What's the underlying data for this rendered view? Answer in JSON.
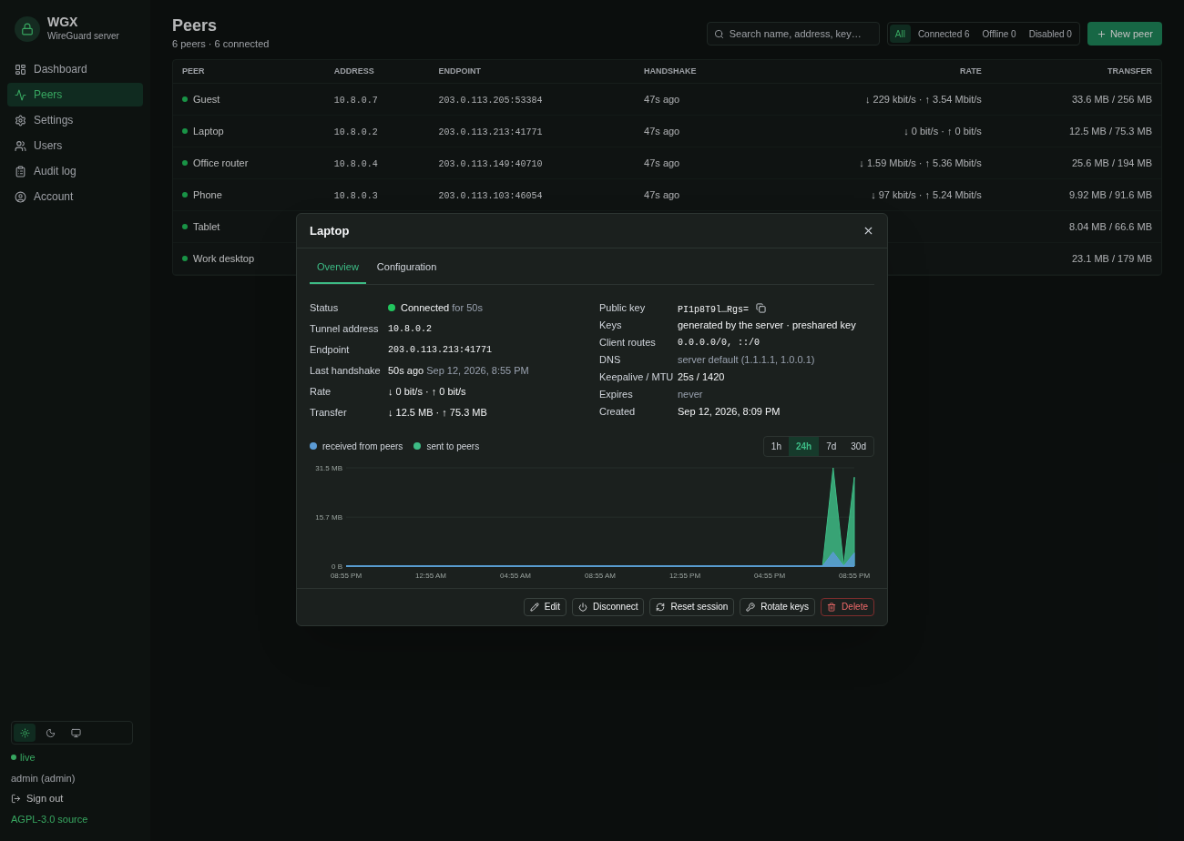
{
  "sidebar": {
    "brand": "WGX",
    "subtitle": "WireGuard server",
    "items": [
      {
        "kind": "dashboard",
        "label": "Dashboard",
        "selected": false
      },
      {
        "kind": "peers",
        "label": "Peers",
        "selected": true
      },
      {
        "kind": "settings",
        "label": "Settings",
        "selected": false
      },
      {
        "kind": "users",
        "label": "Users",
        "selected": false
      },
      {
        "kind": "audit",
        "label": "Audit log",
        "selected": false
      },
      {
        "kind": "account",
        "label": "Account",
        "selected": false
      }
    ],
    "theme_options": [
      {
        "kind": "light",
        "selected": true
      },
      {
        "kind": "dark",
        "selected": false
      },
      {
        "kind": "system",
        "selected": false
      }
    ],
    "live": "live",
    "user": "admin (admin)",
    "sign_out": "Sign out",
    "footer_link": "AGPL-3.0 source"
  },
  "page": {
    "title": "Peers",
    "subtitle": "6 peers · 6 connected",
    "search": {
      "placeholder": "Search name, address, key…"
    },
    "filters": [
      {
        "label": "All",
        "selected": true
      },
      {
        "label": "Connected 6",
        "selected": false
      },
      {
        "label": "Offline 0",
        "selected": false
      },
      {
        "label": "Disabled 0",
        "selected": false
      }
    ],
    "new_button": "New peer"
  },
  "table": {
    "columns": [
      "PEER",
      "ADDRESS",
      "ENDPOINT",
      "HANDSHAKE",
      "RATE",
      "TRANSFER"
    ],
    "rows": [
      {
        "connected": true,
        "name": "Guest",
        "address": "10.8.0.7",
        "endpoint": "203.0.113.205:53384",
        "handshake": "47s ago",
        "rate": "↓ 229 kbit/s · ↑ 3.54 Mbit/s",
        "transfer": "33.6 MB / 256 MB"
      },
      {
        "connected": true,
        "name": "Laptop",
        "address": "10.8.0.2",
        "endpoint": "203.0.113.213:41771",
        "handshake": "47s ago",
        "rate": "↓ 0 bit/s · ↑ 0 bit/s",
        "transfer": "12.5 MB / 75.3 MB"
      },
      {
        "connected": true,
        "name": "Office router",
        "address": "10.8.0.4",
        "endpoint": "203.0.113.149:40710",
        "handshake": "47s ago",
        "rate": "↓ 1.59 Mbit/s · ↑ 5.36 Mbit/s",
        "transfer": "25.6 MB / 194 MB"
      },
      {
        "connected": true,
        "name": "Phone",
        "address": "10.8.0.3",
        "endpoint": "203.0.113.103:46054",
        "handshake": "47s ago",
        "rate": "↓ 97 kbit/s · ↑ 5.24 Mbit/s",
        "transfer": "9.92 MB / 91.6 MB"
      },
      {
        "connected": true,
        "name": "Tablet",
        "transfer": "8.04 MB / 66.6 MB"
      },
      {
        "connected": true,
        "name": "Work desktop",
        "transfer": "23.1 MB / 179 MB"
      }
    ]
  },
  "dialog": {
    "title": "Laptop",
    "tabs": [
      {
        "label": "Overview",
        "selected": true
      },
      {
        "label": "Configuration",
        "selected": false
      }
    ],
    "left": [
      {
        "kind": "status",
        "label": "Status",
        "value": "Connected",
        "note": "for 50s",
        "connected": true
      },
      {
        "kind": "mono",
        "label": "Tunnel address",
        "value": "10.8.0.2"
      },
      {
        "kind": "mono",
        "label": "Endpoint",
        "value": "203.0.113.213:41771"
      },
      {
        "kind": "text",
        "label": "Last handshake",
        "value": "50s ago",
        "note": "Sep 12, 2026, 8:55 PM"
      },
      {
        "kind": "text",
        "label": "Rate",
        "value": "↓ 0 bit/s · ↑ 0 bit/s"
      },
      {
        "kind": "text",
        "label": "Transfer",
        "value": "↓ 12.5 MB · ↑ 75.3 MB"
      }
    ],
    "right": [
      {
        "kind": "key",
        "label": "Public key",
        "value": "PI1p8T9l…Rgs="
      },
      {
        "kind": "text",
        "label": "Keys",
        "value": "generated by the server · preshared key"
      },
      {
        "kind": "mono",
        "label": "Client routes",
        "value": "0.0.0.0/0, ::/0"
      },
      {
        "kind": "muted",
        "label": "DNS",
        "value": "server default (1.1.1.1, 1.0.0.1)"
      },
      {
        "kind": "text",
        "label": "Keepalive / MTU",
        "value": "25s / 1420"
      },
      {
        "kind": "muted",
        "label": "Expires",
        "value": "never"
      },
      {
        "kind": "text",
        "label": "Created",
        "value": "Sep 12, 2026, 8:09 PM"
      }
    ],
    "ranges": [
      {
        "label": "1h",
        "selected": false
      },
      {
        "label": "24h",
        "selected": true
      },
      {
        "label": "7d",
        "selected": false
      },
      {
        "label": "30d",
        "selected": false
      }
    ],
    "chart_data": {
      "type": "area",
      "categories": [
        "08:55 PM",
        null,
        null,
        null,
        null,
        null,
        null,
        null,
        "12:55 AM",
        null,
        null,
        null,
        null,
        null,
        null,
        null,
        "04:55 AM",
        null,
        null,
        null,
        null,
        null,
        null,
        null,
        "08:55 AM",
        null,
        null,
        null,
        null,
        null,
        null,
        null,
        "12:55 PM",
        null,
        null,
        null,
        null,
        null,
        null,
        null,
        "04:55 PM",
        null,
        null,
        null,
        null,
        null,
        null,
        null,
        "08:55 PM"
      ],
      "series": [
        {
          "name": "received from peers",
          "color": "#5b9bd5",
          "values": [
            0,
            0,
            0,
            0,
            0,
            0,
            0,
            0,
            0,
            0,
            0,
            0,
            0,
            0,
            0,
            0,
            0,
            0,
            0,
            0,
            0,
            0,
            0,
            0,
            0,
            0,
            0,
            0,
            0,
            0,
            0,
            0,
            0,
            0,
            0,
            0,
            0,
            0,
            0,
            0,
            0,
            0,
            0,
            0,
            0,
            0,
            4.5,
            0,
            4.2
          ]
        },
        {
          "name": "sent to peers",
          "color": "#3dbb85",
          "values": [
            0,
            0,
            0,
            0,
            0,
            0,
            0,
            0,
            0,
            0,
            0,
            0,
            0,
            0,
            0,
            0,
            0,
            0,
            0,
            0,
            0,
            0,
            0,
            0,
            0,
            0,
            0,
            0,
            0,
            0,
            0,
            0,
            0,
            0,
            0,
            0,
            0,
            0,
            0,
            0,
            0,
            0,
            0,
            0,
            0,
            0,
            31.5,
            0,
            28.5
          ]
        }
      ],
      "ylim": [
        0,
        31.5
      ],
      "yticks": [
        {
          "value": 0,
          "label": "0 B"
        },
        {
          "value": 15.7,
          "label": "15.7 MB"
        },
        {
          "value": 31.5,
          "label": "31.5 MB"
        }
      ]
    },
    "actions": [
      {
        "kind": "edit",
        "label": "Edit"
      },
      {
        "kind": "disconnect",
        "label": "Disconnect"
      },
      {
        "kind": "reset",
        "label": "Reset session"
      },
      {
        "kind": "rotate",
        "label": "Rotate keys"
      },
      {
        "kind": "delete",
        "label": "Delete"
      }
    ]
  }
}
